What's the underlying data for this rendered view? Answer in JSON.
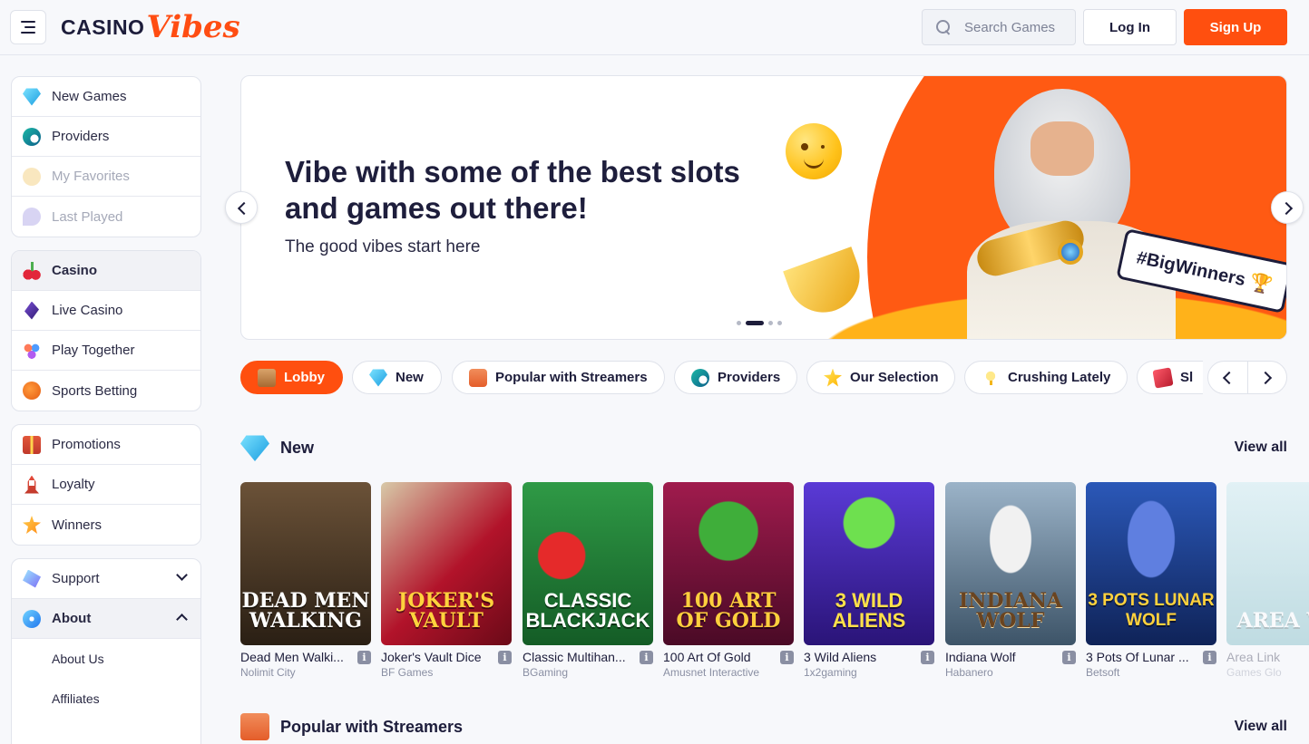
{
  "header": {
    "logo_casino": "CASINO",
    "logo_vibes": "Vibes",
    "search_placeholder": "Search Games",
    "login_label": "Log In",
    "signup_label": "Sign Up"
  },
  "sidebar": {
    "group1": [
      {
        "label": "New Games",
        "icon": "gem-icon"
      },
      {
        "label": "Providers",
        "icon": "globe-icon"
      },
      {
        "label": "My Favorites",
        "icon": "favorites-icon"
      },
      {
        "label": "Last Played",
        "icon": "last-played-icon"
      }
    ],
    "group2": [
      {
        "label": "Casino",
        "icon": "cherry-icon"
      },
      {
        "label": "Live Casino",
        "icon": "live-casino-icon"
      },
      {
        "label": "Play Together",
        "icon": "play-together-icon"
      },
      {
        "label": "Sports Betting",
        "icon": "basketball-icon"
      }
    ],
    "group3": [
      {
        "label": "Promotions",
        "icon": "gift-icon"
      },
      {
        "label": "Loyalty",
        "icon": "rocket-icon"
      },
      {
        "label": "Winners",
        "icon": "winners-icon"
      }
    ],
    "group4": [
      {
        "label": "Support",
        "icon": "support-icon"
      },
      {
        "label": "About",
        "icon": "about-icon"
      },
      {
        "label": "About Us"
      },
      {
        "label": "Affiliates"
      }
    ]
  },
  "hero": {
    "title": "Vibe with some of the best slots and games out there!",
    "subtitle": "The good vibes start here",
    "tag": "#BigWinners 🏆",
    "accent": "#ff5a13"
  },
  "categories": [
    {
      "label": "Lobby",
      "icon": "lobby-icon"
    },
    {
      "label": "New",
      "icon": "gem-icon"
    },
    {
      "label": "Popular with Streamers",
      "icon": "tv-icon"
    },
    {
      "label": "Providers",
      "icon": "globe-icon"
    },
    {
      "label": "Our Selection",
      "icon": "star-icon"
    },
    {
      "label": "Crushing Lately",
      "icon": "lightbulb-icon"
    },
    {
      "label": "Sl",
      "icon": "slot-icon"
    }
  ],
  "sections": {
    "new_title": "New",
    "streamers_title": "Popular with Streamers",
    "view_all": "View all"
  },
  "games": [
    {
      "name": "Dead Men Walki...",
      "provider": "Nolimit City",
      "art": "DEAD MEN WALKING",
      "bg": "#4a3a2a"
    },
    {
      "name": "Joker's Vault Dice",
      "provider": "BF Games",
      "art": "JOKER'S VAULT",
      "bg": "#b2132a"
    },
    {
      "name": "Classic Multihan...",
      "provider": "BGaming",
      "art": "CLASSIC BLACKJACK",
      "bg": "#1f7a34"
    },
    {
      "name": "100 Art Of Gold",
      "provider": "Amusnet Interactive",
      "art": "100 ART OF GOLD",
      "bg": "#7a1240"
    },
    {
      "name": "3 Wild Aliens",
      "provider": "1x2gaming",
      "art": "3 WILD ALIENS",
      "bg": "#4b2bb8"
    },
    {
      "name": "Indiana Wolf",
      "provider": "Habanero",
      "art": "INDIANA WOLF",
      "bg": "#6f8aa0"
    },
    {
      "name": "3 Pots Of Lunar ...",
      "provider": "Betsoft",
      "art": "3 POTS LUNAR WOLF",
      "bg": "#1e3f8f"
    },
    {
      "name": "Area Link",
      "provider": "Games Glo",
      "art": "AREA WO",
      "bg": "#7cc1c9"
    }
  ],
  "colors": {
    "brand_orange": "#ff4f0f",
    "text_dark": "#1d1d3b",
    "muted": "#8a8fa3"
  }
}
